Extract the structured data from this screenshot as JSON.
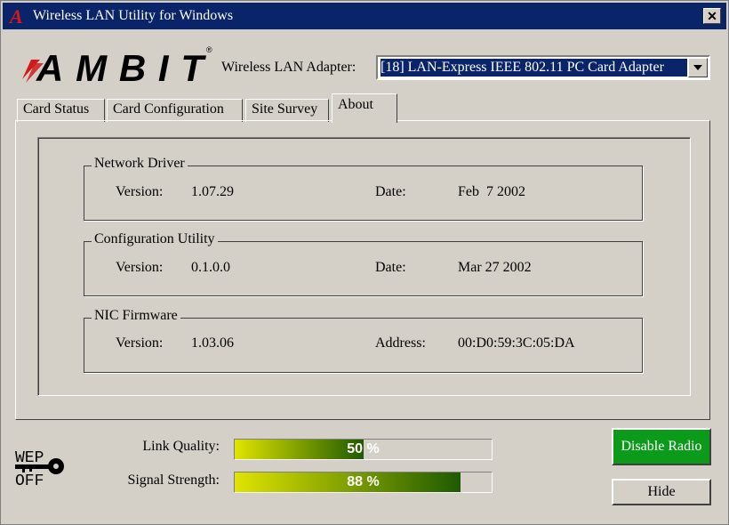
{
  "window": {
    "title": "Wireless LAN Utility for Windows",
    "close_label": "✕",
    "title_logo_glyph": "A"
  },
  "brand": {
    "logo_text": "AMBIT",
    "registered_mark": "®"
  },
  "adapter": {
    "label": "Wireless LAN Adapter:",
    "selected": "[18] LAN-Express IEEE 802.11 PC Card Adapter"
  },
  "tabs": [
    {
      "label": "Card Status"
    },
    {
      "label": "Card Configuration"
    },
    {
      "label": "Site Survey"
    },
    {
      "label": "About",
      "active": true
    }
  ],
  "groups": [
    {
      "title": "Network Driver",
      "field1_label": "Version:",
      "field1_value": "1.07.29",
      "field2_label": "Date:",
      "field2_value": "Feb  7 2002"
    },
    {
      "title": "Configuration Utility",
      "field1_label": "Version:",
      "field1_value": "0.1.0.0",
      "field2_label": "Date:",
      "field2_value": "Mar 27 2002"
    },
    {
      "title": "NIC Firmware",
      "field1_label": "Version:",
      "field1_value": "1.03.06",
      "field2_label": "Address:",
      "field2_value": "00:D0:59:3C:05:DA"
    }
  ],
  "status": {
    "wep_top": "WEP",
    "wep_bottom": "OFF",
    "link_quality": {
      "label": "Link Quality:",
      "value_text": "50 %",
      "percent": 50
    },
    "signal_strength": {
      "label": "Signal Strength:",
      "value_text": "88 %",
      "percent": 88
    }
  },
  "buttons": {
    "disable_radio": "Disable Radio",
    "hide": "Hide"
  },
  "colors": {
    "title_bar": "#0a246a",
    "disable_radio_bg": "#0b9a1a",
    "meter_start": "#e0e400",
    "meter_end": "#1f5a00",
    "logo_red": "#d11a1a"
  }
}
